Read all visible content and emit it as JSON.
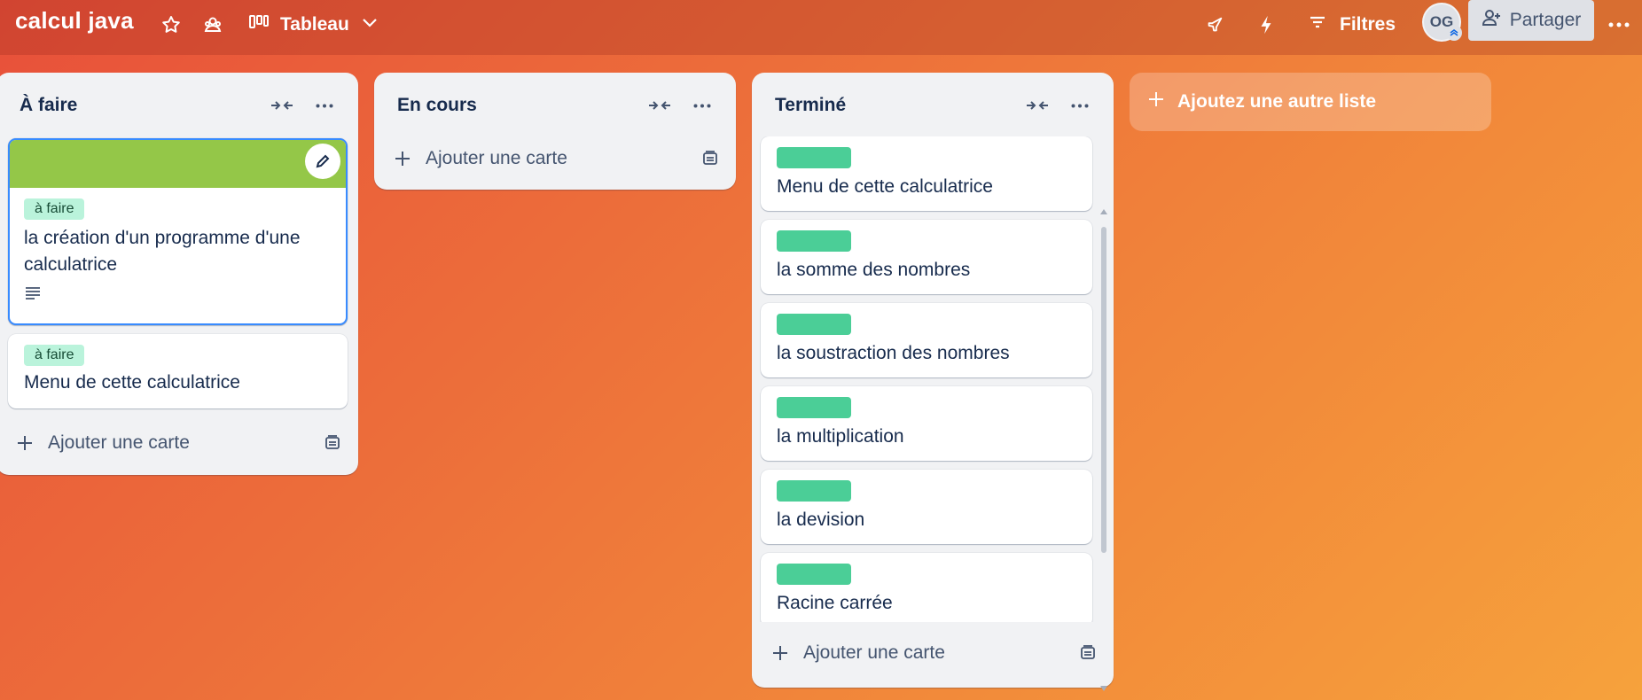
{
  "board": {
    "title": "calcul java",
    "view_label": "Tableau",
    "filters_label": "Filtres",
    "avatar_initials": "OG",
    "share_label": "Partager"
  },
  "lists": [
    {
      "title": "À faire",
      "cards": [
        {
          "has_cover": true,
          "cover_color": "#94c748",
          "label": "à faire",
          "title": "la création d'un programme d'une calculatrice",
          "has_description": true,
          "selected": true
        },
        {
          "has_cover": false,
          "label": "à faire",
          "title": "Menu de cette calculatrice"
        }
      ],
      "add_card_label": "Ajouter une carte"
    },
    {
      "title": "En cours",
      "cards": [],
      "add_card_label": "Ajouter une carte"
    },
    {
      "title": "Terminé",
      "cards": [
        {
          "label_color": "#4bce97",
          "title": "Menu de cette calculatrice"
        },
        {
          "label_color": "#4bce97",
          "title": "la somme des nombres"
        },
        {
          "label_color": "#4bce97",
          "title": "la soustraction des nombres"
        },
        {
          "label_color": "#4bce97",
          "title": "la multiplication"
        },
        {
          "label_color": "#4bce97",
          "title": "la devision"
        },
        {
          "label_color": "#4bce97",
          "title": "Racine carrée"
        }
      ],
      "add_card_label": "Ajouter une carte"
    }
  ],
  "add_list_label": "Ajoutez une autre liste",
  "colors": {
    "background_start": "#e8503a",
    "background_end": "#f6a23c",
    "label_green_light": "#baf3db",
    "label_green": "#4bce97",
    "cover_green": "#94c748",
    "selection_blue": "#388bff"
  }
}
